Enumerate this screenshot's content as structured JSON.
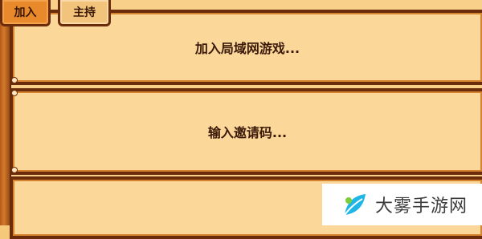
{
  "tabs": [
    {
      "label": "加入",
      "active": true
    },
    {
      "label": "主持",
      "active": false
    }
  ],
  "options": [
    {
      "label": "加入局域网游戏..."
    },
    {
      "label": "输入邀请码..."
    }
  ],
  "watermark": {
    "text": "大雾手游网"
  },
  "colors": {
    "panel_bg": "#fbd79a",
    "border": "#6a2c0b",
    "active_tab": "#e88a2b",
    "inactive_tab": "#f2c47b",
    "text": "#3b1a0a"
  }
}
